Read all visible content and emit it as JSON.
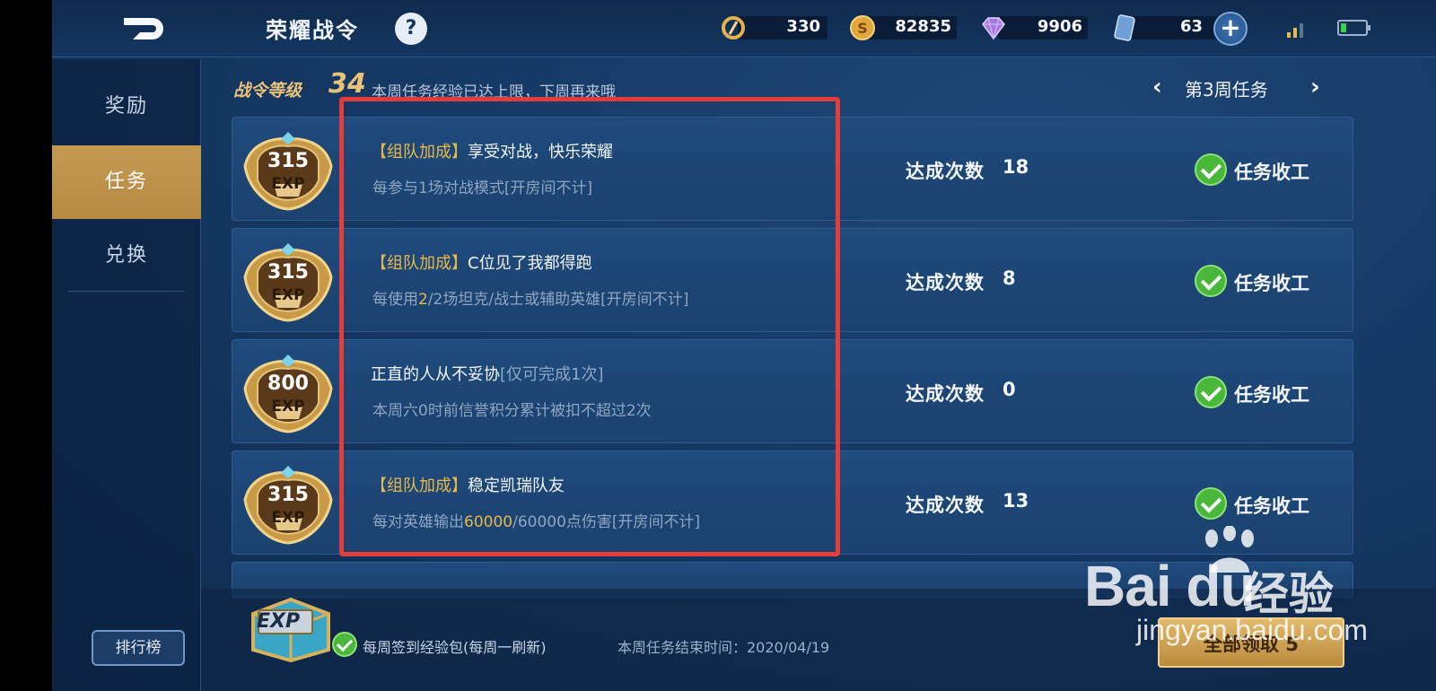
{
  "header": {
    "title": "荣耀战令",
    "help_label": "?",
    "resources": [
      {
        "icon": "badge-coin-icon",
        "value": "330"
      },
      {
        "icon": "gold-coin-icon",
        "value": "82835"
      },
      {
        "icon": "diamond-icon",
        "value": "9906"
      },
      {
        "icon": "voucher-card-icon",
        "value": "63"
      }
    ],
    "add_label": "+"
  },
  "sidebar": {
    "items": [
      {
        "label": "奖励",
        "active": false
      },
      {
        "label": "任务",
        "active": true
      },
      {
        "label": "兑换",
        "active": false
      }
    ],
    "rank_button": "排行榜"
  },
  "level": {
    "label": "战令等级",
    "value": "34",
    "note": "本周任务经验已达上限，下周再来哦"
  },
  "week": {
    "label": "第3周任务",
    "prev": "‹",
    "next": "›"
  },
  "tasks": [
    {
      "exp": "315",
      "exp_unit": "EXP",
      "tag": "【组队加成】",
      "title": "享受对战，快乐荣耀",
      "limit": "",
      "desc_pre": "每参与1场对战模式[开房间不计]",
      "desc_hl": "",
      "desc_post": "",
      "count_label": "达成次数",
      "count": "18",
      "status": "任务收工"
    },
    {
      "exp": "315",
      "exp_unit": "EXP",
      "tag": "【组队加成】",
      "title": "C位见了我都得跑",
      "limit": "",
      "desc_pre": "每使用",
      "desc_hl": "2",
      "desc_post": "/2场坦克/战士或辅助英雄[开房间不计]",
      "count_label": "达成次数",
      "count": "8",
      "status": "任务收工"
    },
    {
      "exp": "800",
      "exp_unit": "EXP",
      "tag": "",
      "title": "正直的人从不妥协",
      "limit": "[仅可完成1次]",
      "desc_pre": "本周六0时前信誉积分累计被扣不超过2次",
      "desc_hl": "",
      "desc_post": "",
      "count_label": "达成次数",
      "count": "0",
      "status": "任务收工"
    },
    {
      "exp": "315",
      "exp_unit": "EXP",
      "tag": "【组队加成】",
      "title": "稳定凯瑞队友",
      "limit": "",
      "desc_pre": "每对英雄输出",
      "desc_hl": "60000",
      "desc_post": "/60000点伤害[开房间不计]",
      "count_label": "达成次数",
      "count": "13",
      "status": "任务收工"
    }
  ],
  "bottom": {
    "chest_label": "EXP",
    "daily_label": "每周签到经验包(每周一刷新)",
    "end_time": "本周任务结束时间：2020/04/19",
    "claim_label": "全部领取 5"
  },
  "watermark": {
    "logo": "Bai du",
    "brand": "经验",
    "url": "jingyan.baidu.com"
  },
  "colors": {
    "accent_gold": "#e7b84a",
    "highlight_red": "#e23d3a",
    "complete_green": "#49b83a",
    "panel_blue": "#1f4a7c"
  }
}
